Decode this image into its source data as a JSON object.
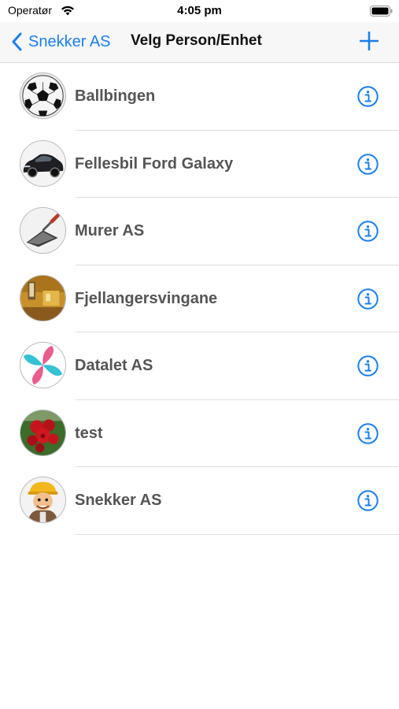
{
  "status_bar": {
    "carrier": "Operatør",
    "time": "4:05 pm",
    "wifi_icon": "wifi-icon",
    "battery_icon": "battery-icon"
  },
  "nav": {
    "back_label": "Snekker AS",
    "title": "Velg Person/Enhet",
    "add_icon": "plus-icon"
  },
  "colors": {
    "accent": "#1a7ff0",
    "row_text": "#555555",
    "separator": "#dedee2",
    "nav_background": "#f7f7f8"
  },
  "items": [
    {
      "label": "Ballbingen",
      "avatar": "soccer-ball-image"
    },
    {
      "label": "Fellesbil Ford Galaxy",
      "avatar": "car-image"
    },
    {
      "label": "Murer AS",
      "avatar": "trowel-image"
    },
    {
      "label": "Fjellangersvingane",
      "avatar": "room-image"
    },
    {
      "label": "Datalet AS",
      "avatar": "logo-image"
    },
    {
      "label": "test",
      "avatar": "roses-image"
    },
    {
      "label": "Snekker AS",
      "avatar": "carpenter-image"
    }
  ]
}
